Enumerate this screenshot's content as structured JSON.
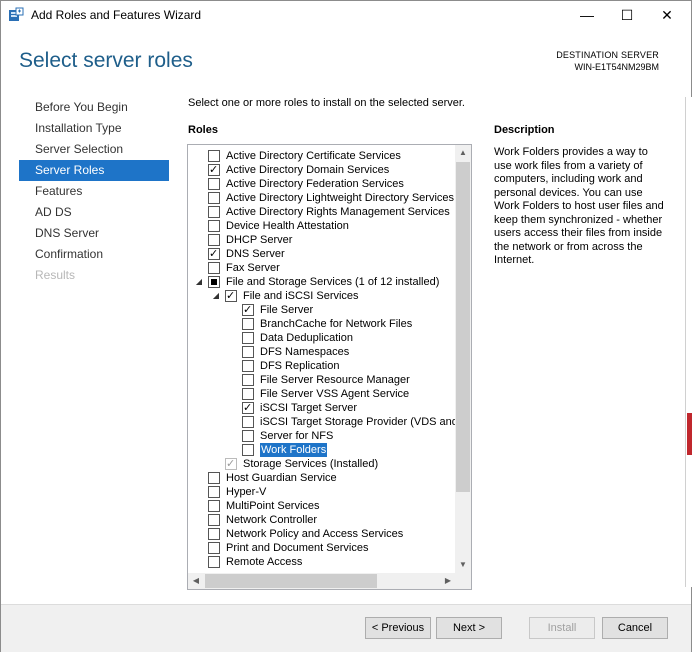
{
  "window": {
    "title": "Add Roles and Features Wizard",
    "minimize_glyph": "—",
    "maximize_glyph": "☐",
    "close_glyph": "✕"
  },
  "header": {
    "page_title": "Select server roles",
    "destination_label": "DESTINATION SERVER",
    "destination_name": "WIN-E1T54NM29BM"
  },
  "nav": {
    "items": [
      {
        "label": "Before You Begin",
        "state": "normal"
      },
      {
        "label": "Installation Type",
        "state": "normal"
      },
      {
        "label": "Server Selection",
        "state": "normal"
      },
      {
        "label": "Server Roles",
        "state": "active"
      },
      {
        "label": "Features",
        "state": "normal"
      },
      {
        "label": "AD DS",
        "state": "normal"
      },
      {
        "label": "DNS Server",
        "state": "normal"
      },
      {
        "label": "Confirmation",
        "state": "normal"
      },
      {
        "label": "Results",
        "state": "disabled"
      }
    ]
  },
  "content": {
    "intro": "Select one or more roles to install on the selected server.",
    "roles_heading": "Roles",
    "description_heading": "Description",
    "description_text": "Work Folders provides a way to use work files from a variety of computers, including work and personal devices. You can use Work Folders to host user files and keep them synchronized - whether users access their files from inside the network or from across the Internet."
  },
  "roles": [
    {
      "label": "Active Directory Certificate Services",
      "level": 0,
      "check": "none",
      "expander": ""
    },
    {
      "label": "Active Directory Domain Services",
      "level": 0,
      "check": "checked",
      "expander": ""
    },
    {
      "label": "Active Directory Federation Services",
      "level": 0,
      "check": "none",
      "expander": ""
    },
    {
      "label": "Active Directory Lightweight Directory Services",
      "level": 0,
      "check": "none",
      "expander": ""
    },
    {
      "label": "Active Directory Rights Management Services",
      "level": 0,
      "check": "none",
      "expander": ""
    },
    {
      "label": "Device Health Attestation",
      "level": 0,
      "check": "none",
      "expander": ""
    },
    {
      "label": "DHCP Server",
      "level": 0,
      "check": "none",
      "expander": ""
    },
    {
      "label": "DNS Server",
      "level": 0,
      "check": "checked",
      "expander": ""
    },
    {
      "label": "Fax Server",
      "level": 0,
      "check": "none",
      "expander": ""
    },
    {
      "label": "File and Storage Services (1 of 12 installed)",
      "level": 0,
      "check": "partial",
      "expander": "◢"
    },
    {
      "label": "File and iSCSI Services",
      "level": 1,
      "check": "checked",
      "expander": "◢"
    },
    {
      "label": "File Server",
      "level": 2,
      "check": "checked",
      "expander": ""
    },
    {
      "label": "BranchCache for Network Files",
      "level": 2,
      "check": "none",
      "expander": ""
    },
    {
      "label": "Data Deduplication",
      "level": 2,
      "check": "none",
      "expander": ""
    },
    {
      "label": "DFS Namespaces",
      "level": 2,
      "check": "none",
      "expander": ""
    },
    {
      "label": "DFS Replication",
      "level": 2,
      "check": "none",
      "expander": ""
    },
    {
      "label": "File Server Resource Manager",
      "level": 2,
      "check": "none",
      "expander": ""
    },
    {
      "label": "File Server VSS Agent Service",
      "level": 2,
      "check": "none",
      "expander": ""
    },
    {
      "label": "iSCSI Target Server",
      "level": 2,
      "check": "checked",
      "expander": ""
    },
    {
      "label": "iSCSI Target Storage Provider (VDS and VSS",
      "level": 2,
      "check": "none",
      "expander": ""
    },
    {
      "label": "Server for NFS",
      "level": 2,
      "check": "none",
      "expander": ""
    },
    {
      "label": "Work Folders",
      "level": 2,
      "check": "none",
      "expander": "",
      "selected": true
    },
    {
      "label": "Storage Services (Installed)",
      "level": 1,
      "check": "disabled-checked",
      "expander": ""
    },
    {
      "label": "Host Guardian Service",
      "level": 0,
      "check": "none",
      "expander": ""
    },
    {
      "label": "Hyper-V",
      "level": 0,
      "check": "none",
      "expander": ""
    },
    {
      "label": "MultiPoint Services",
      "level": 0,
      "check": "none",
      "expander": ""
    },
    {
      "label": "Network Controller",
      "level": 0,
      "check": "none",
      "expander": ""
    },
    {
      "label": "Network Policy and Access Services",
      "level": 0,
      "check": "none",
      "expander": ""
    },
    {
      "label": "Print and Document Services",
      "level": 0,
      "check": "none",
      "expander": ""
    },
    {
      "label": "Remote Access",
      "level": 0,
      "check": "none",
      "expander": ""
    }
  ],
  "footer": {
    "previous_label": "< Previous",
    "next_label": "Next >",
    "install_label": "Install",
    "cancel_label": "Cancel"
  },
  "colors": {
    "accent": "#1e74c8",
    "title_blue": "#1e5e8a"
  }
}
